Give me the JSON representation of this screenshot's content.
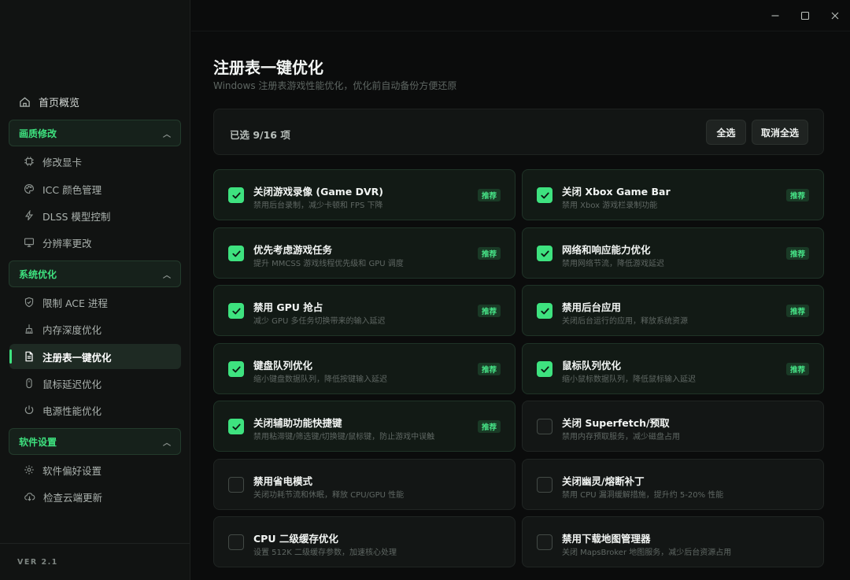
{
  "window": {
    "minimize_icon": "minimize-icon",
    "maximize_icon": "maximize-icon",
    "close_icon": "close-icon"
  },
  "sidebar": {
    "home": "首页概览",
    "groups": [
      {
        "label": "画质修改",
        "items": [
          "修改显卡",
          "ICC 颜色管理",
          "DLSS 模型控制",
          "分辨率更改"
        ]
      },
      {
        "label": "系统优化",
        "items": [
          "限制 ACE 进程",
          "内存深度优化",
          "注册表一键优化",
          "鼠标延迟优化",
          "电源性能优化"
        ]
      },
      {
        "label": "软件设置",
        "items": [
          "软件偏好设置",
          "检查云端更新"
        ]
      }
    ],
    "active_item": "注册表一键优化",
    "version": "VER 2.1"
  },
  "page": {
    "title": "注册表一键优化",
    "subtitle": "Windows 注册表游戏性能优化，优化前自动备份方便还原",
    "selected_count": "已选 9/16 项",
    "select_all": "全选",
    "deselect_all": "取消全选"
  },
  "options": [
    {
      "title": "关闭游戏录像 (Game DVR)",
      "desc": "禁用后台录制，减少卡顿和 FPS 下降",
      "badge": "推荐",
      "checked": true
    },
    {
      "title": "关闭 Xbox Game Bar",
      "desc": "禁用 Xbox 游戏栏录制功能",
      "badge": "推荐",
      "checked": true
    },
    {
      "title": "优先考虑游戏任务",
      "desc": "提升 MMCSS 游戏线程优先级和 GPU 调度",
      "badge": "推荐",
      "checked": true
    },
    {
      "title": "网络和响应能力优化",
      "desc": "禁用网络节流，降低游戏延迟",
      "badge": "推荐",
      "checked": true
    },
    {
      "title": "禁用 GPU 抢占",
      "desc": "减少 GPU 多任务切换带来的输入延迟",
      "badge": "推荐",
      "checked": true
    },
    {
      "title": "禁用后台应用",
      "desc": "关闭后台运行的应用，释放系统资源",
      "badge": "推荐",
      "checked": true
    },
    {
      "title": "键盘队列优化",
      "desc": "缩小键盘数据队列，降低按键输入延迟",
      "badge": "推荐",
      "checked": true
    },
    {
      "title": "鼠标队列优化",
      "desc": "缩小鼠标数据队列，降低鼠标输入延迟",
      "badge": "推荐",
      "checked": true
    },
    {
      "title": "关闭辅助功能快捷键",
      "desc": "禁用粘滞键/筛选键/切换键/鼠标键，防止游戏中误触",
      "badge": "推荐",
      "checked": true
    },
    {
      "title": "关闭 Superfetch/预取",
      "desc": "禁用内存预取服务，减少磁盘占用",
      "badge": "",
      "checked": false
    },
    {
      "title": "禁用省电模式",
      "desc": "关闭功耗节流和休眠，释放 CPU/GPU 性能",
      "badge": "",
      "checked": false
    },
    {
      "title": "关闭幽灵/熔断补丁",
      "desc": "禁用 CPU 漏洞缓解措施，提升约 5-20% 性能",
      "badge": "",
      "checked": false
    },
    {
      "title": "CPU 二级缓存优化",
      "desc": "设置 512K 二级缓存参数，加速核心处理",
      "badge": "",
      "checked": false
    },
    {
      "title": "禁用下载地图管理器",
      "desc": "关闭 MapsBroker 地图服务，减少后台资源占用",
      "badge": "",
      "checked": false
    }
  ],
  "colors": {
    "accent": "#3ee27f",
    "background": "#0b0c0c",
    "sidebar": "#111312",
    "card": "#131615"
  }
}
